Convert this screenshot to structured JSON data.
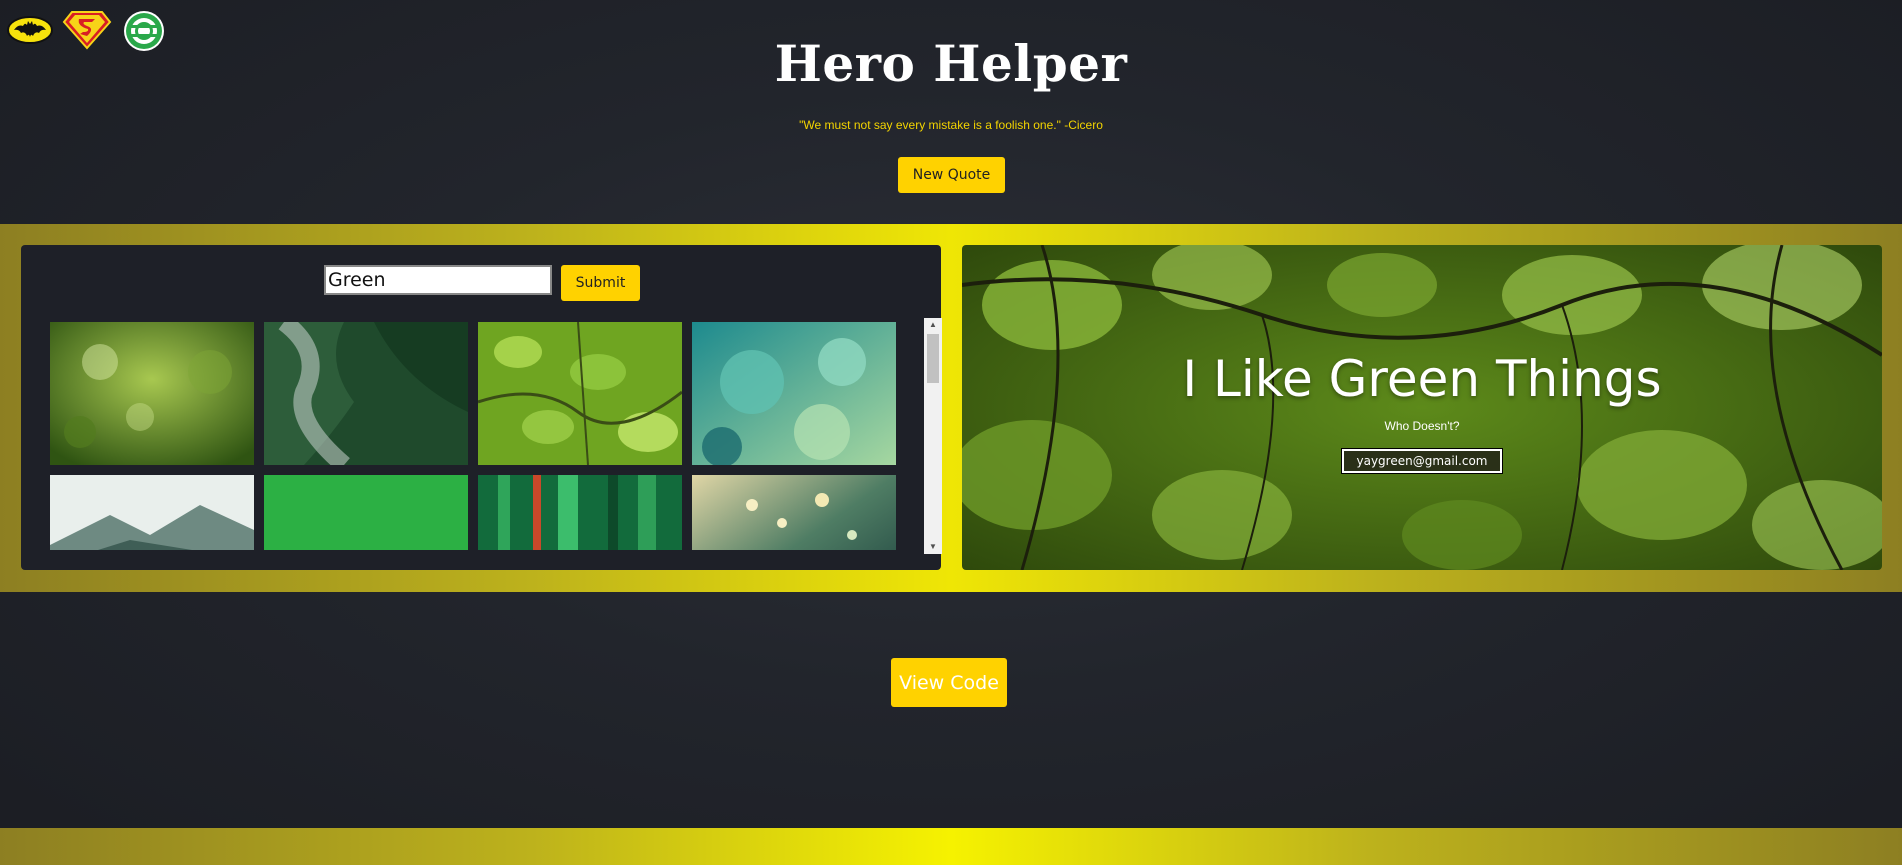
{
  "header": {
    "title": "Hero Helper",
    "quote": "\"We must not say every mistake is a foolish one.\" -Cicero",
    "new_quote_label": "New Quote"
  },
  "hero_icons": [
    "batman-icon",
    "superman-icon",
    "green-lantern-icon"
  ],
  "search": {
    "value": "Green",
    "submit_label": "Submit"
  },
  "gallery": {
    "images": [
      "green bokeh foliage",
      "misty green forest aerial",
      "backlit green leaves",
      "teal bubbles",
      "misty mountain",
      "green fabric texture",
      "green abstract streaks",
      "bokeh light teal"
    ]
  },
  "feature": {
    "title": "I Like Green Things",
    "subtitle": "Who Doesn't?",
    "email_value": "yaygreen@gmail.com"
  },
  "footer": {
    "view_code_label": "View Code"
  },
  "colors": {
    "accent": "#ffd200",
    "background": "#22252c",
    "band": "#efe605"
  }
}
